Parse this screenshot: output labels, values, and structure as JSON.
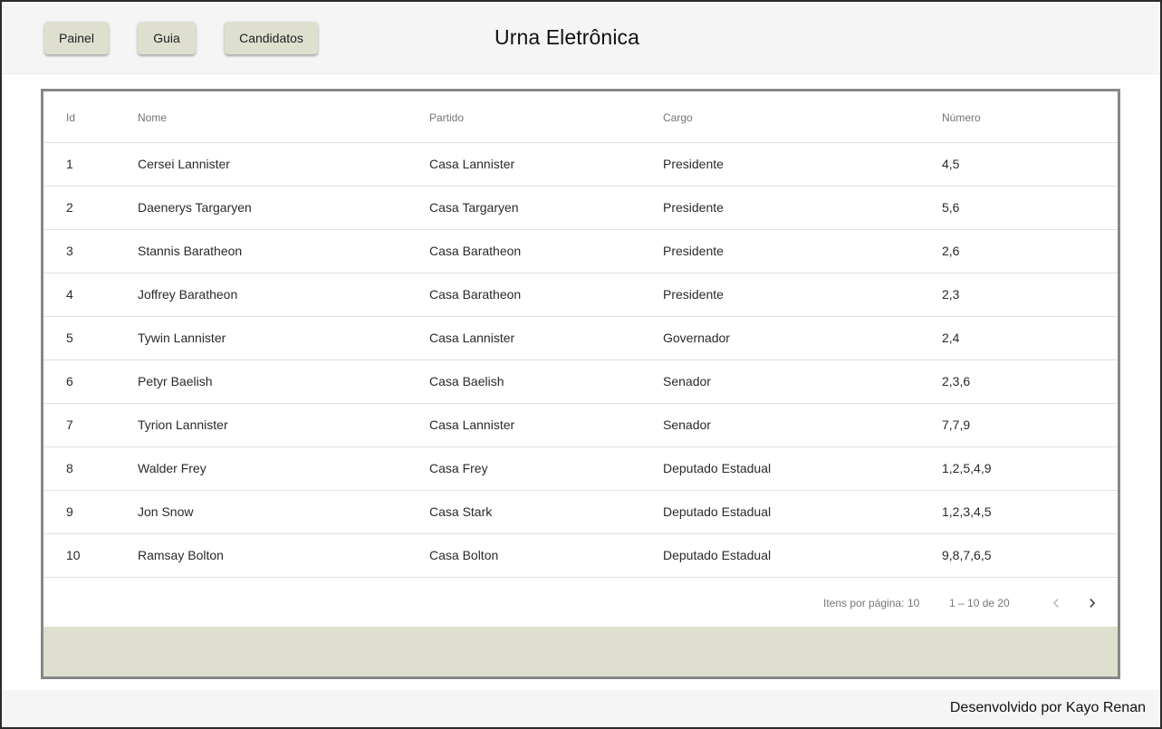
{
  "nav": {
    "buttons": [
      {
        "label": "Painel"
      },
      {
        "label": "Guia"
      },
      {
        "label": "Candidatos"
      }
    ],
    "title": "Urna Eletrônica"
  },
  "table": {
    "headers": {
      "id": "Id",
      "nome": "Nome",
      "partido": "Partido",
      "cargo": "Cargo",
      "numero": "Número"
    },
    "rows": [
      {
        "id": "1",
        "nome": "Cersei Lannister",
        "partido": "Casa Lannister",
        "cargo": "Presidente",
        "numero": "4,5"
      },
      {
        "id": "2",
        "nome": "Daenerys Targaryen",
        "partido": "Casa Targaryen",
        "cargo": "Presidente",
        "numero": "5,6"
      },
      {
        "id": "3",
        "nome": "Stannis Baratheon",
        "partido": "Casa Baratheon",
        "cargo": "Presidente",
        "numero": "2,6"
      },
      {
        "id": "4",
        "nome": "Joffrey Baratheon",
        "partido": "Casa Baratheon",
        "cargo": "Presidente",
        "numero": "2,3"
      },
      {
        "id": "5",
        "nome": "Tywin Lannister",
        "partido": "Casa Lannister",
        "cargo": "Governador",
        "numero": "2,4"
      },
      {
        "id": "6",
        "nome": "Petyr Baelish",
        "partido": "Casa Baelish",
        "cargo": "Senador",
        "numero": "2,3,6"
      },
      {
        "id": "7",
        "nome": "Tyrion Lannister",
        "partido": "Casa Lannister",
        "cargo": "Senador",
        "numero": "7,7,9"
      },
      {
        "id": "8",
        "nome": "Walder Frey",
        "partido": "Casa Frey",
        "cargo": "Deputado Estadual",
        "numero": "1,2,5,4,9"
      },
      {
        "id": "9",
        "nome": "Jon Snow",
        "partido": "Casa Stark",
        "cargo": "Deputado Estadual",
        "numero": "1,2,3,4,5"
      },
      {
        "id": "10",
        "nome": "Ramsay Bolton",
        "partido": "Casa Bolton",
        "cargo": "Deputado Estadual",
        "numero": "9,8,7,6,5"
      }
    ]
  },
  "paginator": {
    "items_label": "Itens por página:",
    "page_size": "10",
    "range": "1 – 10 de 20",
    "prev_icon": "chevron-left-icon",
    "next_icon": "chevron-right-icon"
  },
  "footer": {
    "text": "Desenvolvido por Kayo Renan"
  },
  "colors": {
    "button_bg": "#dedfcf",
    "topbar_bg": "#f5f5f5",
    "frame_border": "#878787",
    "band_bg": "#dedfcf"
  }
}
